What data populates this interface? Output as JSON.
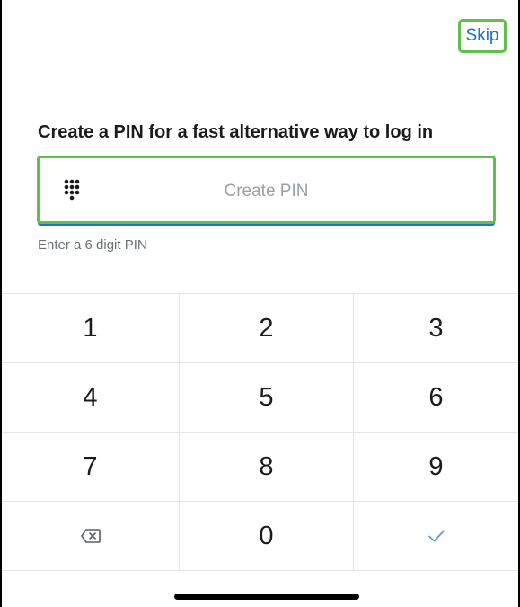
{
  "header": {
    "skip_label": "Skip"
  },
  "heading": "Create a PIN for a fast alternative way to log in",
  "pin_input": {
    "placeholder": "Create PIN",
    "value": "",
    "icon": "keypad-icon",
    "hint": "Enter a 6 digit PIN"
  },
  "keypad": {
    "rows": [
      [
        "1",
        "2",
        "3"
      ],
      [
        "4",
        "5",
        "6"
      ],
      [
        "7",
        "8",
        "9"
      ]
    ],
    "zero": "0",
    "backspace_icon": "backspace-icon",
    "confirm_icon": "checkmark-icon"
  },
  "colors": {
    "accent": "#1f6fd6",
    "highlight": "#5fc04a",
    "text": "#1b1b1b",
    "muted": "#9aa0a6"
  }
}
